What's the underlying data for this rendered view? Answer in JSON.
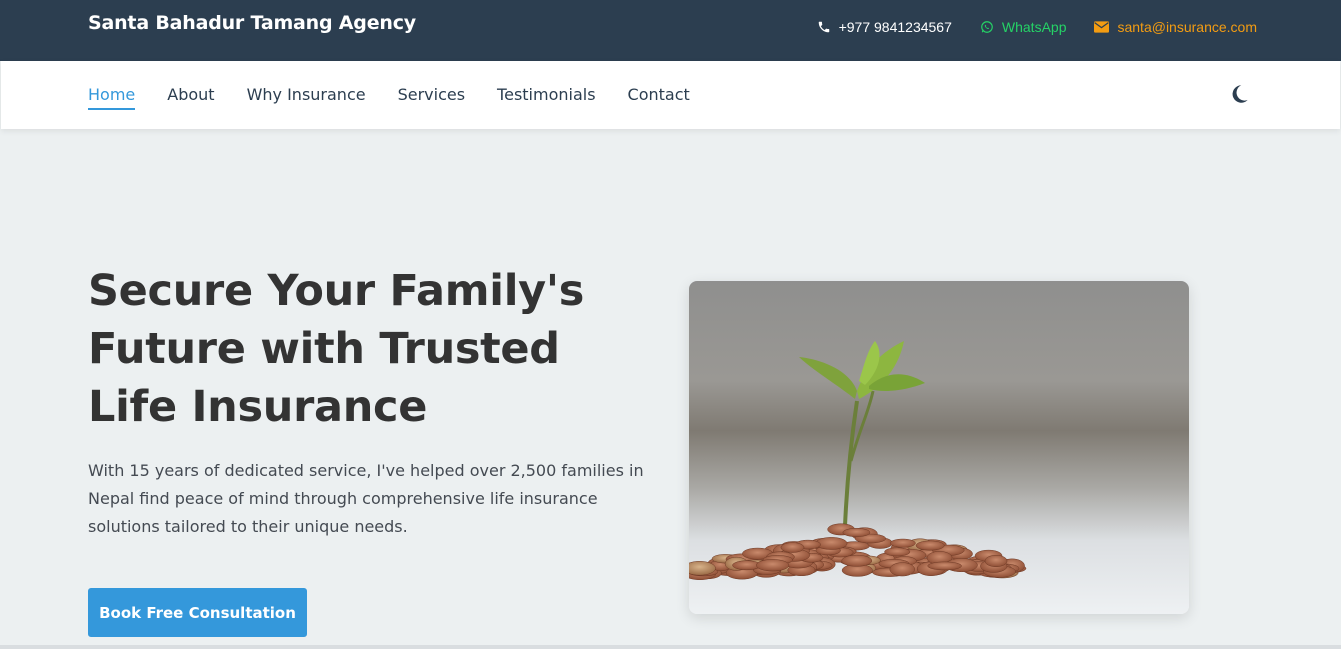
{
  "topbar": {
    "brand": "Santa Bahadur Tamang Agency",
    "phone": "+977 9841234567",
    "whatsapp": "WhatsApp",
    "email": "santa@insurance.com",
    "icons": {
      "phone": "phone-icon",
      "whatsapp": "whatsapp-icon",
      "email": "envelope-icon"
    },
    "colors": {
      "background": "#2c3e50",
      "whatsapp": "#25d366",
      "email": "#f39c12"
    }
  },
  "nav": {
    "items": [
      {
        "label": "Home",
        "active": true
      },
      {
        "label": "About"
      },
      {
        "label": "Why Insurance"
      },
      {
        "label": "Services"
      },
      {
        "label": "Testimonials"
      },
      {
        "label": "Contact"
      }
    ],
    "theme_toggle_icon": "moon-icon",
    "active_color": "#3498db"
  },
  "hero": {
    "title": "Secure Your Family's Future with Trusted Life Insurance",
    "text": "With 15 years of dedicated service, I've helped over 2,500 families in Nepal find peace of mind through comprehensive life insurance solutions tailored to their unique needs.",
    "cta_label": "Book Free Consultation",
    "image": "plant-growing-from-coins-photo",
    "cta_color": "#3498db"
  }
}
